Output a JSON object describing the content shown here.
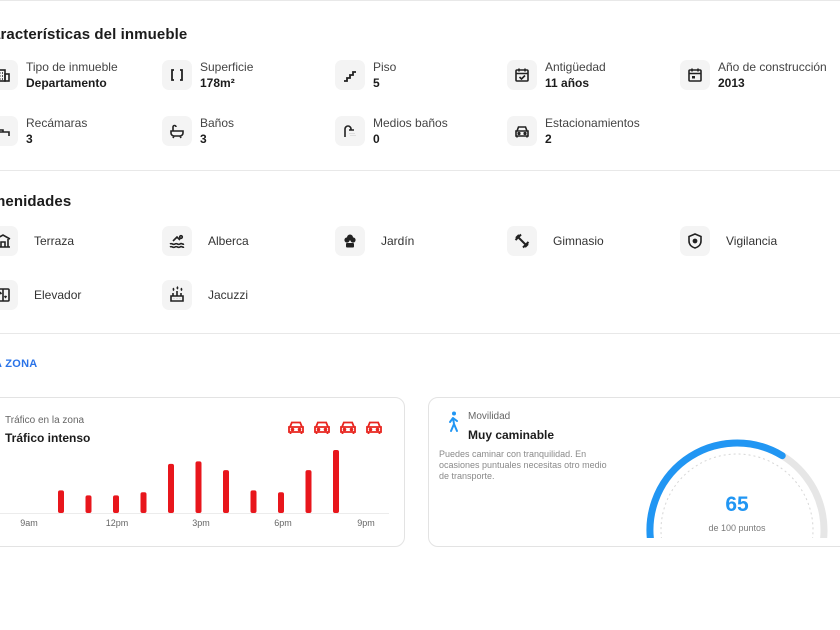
{
  "features": {
    "title": "aracterísticas del inmueble",
    "items": [
      {
        "label": "Tipo de inmueble",
        "value": "Departamento",
        "icon": "building-icon"
      },
      {
        "label": "Superficie",
        "value": "178m²",
        "icon": "area-brackets-icon"
      },
      {
        "label": "Piso",
        "value": "5",
        "icon": "stairs-icon"
      },
      {
        "label": "Antigüedad",
        "value": "11 años",
        "icon": "calendar-check-icon"
      },
      {
        "label": "Año de construcción",
        "value": "2013",
        "icon": "calendar-icon"
      },
      {
        "label": "Recámaras",
        "value": "3",
        "icon": "bed-icon"
      },
      {
        "label": "Baños",
        "value": "3",
        "icon": "bathtub-icon"
      },
      {
        "label": "Medios baños",
        "value": "0",
        "icon": "shower-icon"
      },
      {
        "label": "Estacionamientos",
        "value": "2",
        "icon": "car-icon"
      }
    ]
  },
  "amenities": {
    "title": "menidades",
    "items": [
      {
        "label": "Terraza",
        "icon": "terrace-icon"
      },
      {
        "label": "Alberca",
        "icon": "pool-icon"
      },
      {
        "label": "Jardín",
        "icon": "garden-icon"
      },
      {
        "label": "Gimnasio",
        "icon": "gym-icon"
      },
      {
        "label": "Vigilancia",
        "icon": "shield-icon"
      },
      {
        "label": "Elevador",
        "icon": "elevator-icon"
      },
      {
        "label": "Jacuzzi",
        "icon": "jacuzzi-icon"
      }
    ]
  },
  "zone": {
    "title": "A ZONA",
    "traffic": {
      "label": "Tráfico en la zona",
      "value": "Tráfico intenso",
      "level": 4,
      "level_max": 4,
      "car_color": "#e8251f"
    },
    "mobility": {
      "label": "Movilidad",
      "value": "Muy caminable",
      "description": "Puedes caminar con tranquilidad. En ocasiones puntuales necesitas otro medio de transporte.",
      "score": 65,
      "score_max": 100,
      "score_text": "65",
      "score_suffix": "de 100 puntos",
      "color": "#2196f3"
    }
  },
  "chart_data": {
    "type": "bar",
    "x_tick_labels": [
      "9am",
      "12pm",
      "3pm",
      "6pm",
      "9pm"
    ],
    "values": [
      0.36,
      0.28,
      0.28,
      0.33,
      0.78,
      0.82,
      0.68,
      0.36,
      0.33,
      0.68,
      1.0
    ],
    "ylim": [
      0,
      1
    ],
    "bar_color": "#e8161c",
    "grid": false
  }
}
